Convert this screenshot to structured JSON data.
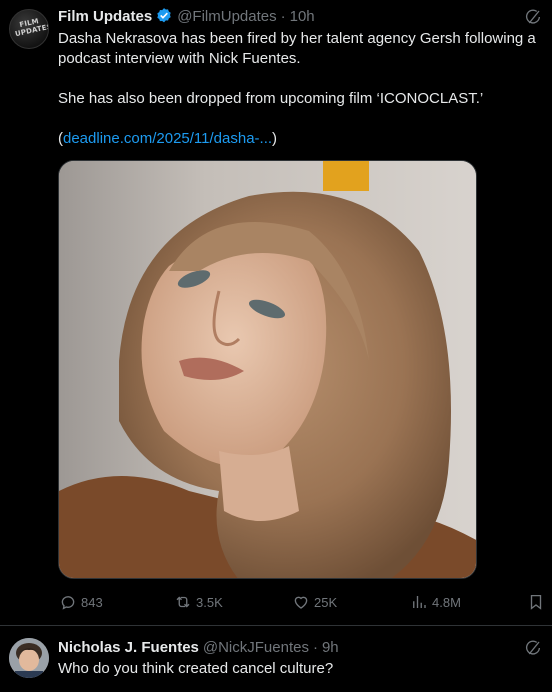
{
  "tweet": {
    "author_name": "Film Updates",
    "handle": "@FilmUpdates",
    "separator": "·",
    "time": "10h",
    "avatar_text_line1": "FILM",
    "avatar_text_line2": "UPDATES",
    "text_line1": "Dasha Nekrasova has been fired by her talent agency Gersh following a",
    "text_line2": "podcast interview with Nick Fuentes.",
    "text_line3": "She has also been dropped from upcoming film ‘ICONOCLAST.’",
    "link_open": "(",
    "link_text": "deadline.com/2025/11/dasha-...",
    "link_close": ")",
    "stats": {
      "replies": "843",
      "reposts": "3.5K",
      "likes": "25K",
      "views": "4.8M"
    }
  },
  "reply": {
    "author_name": "Nicholas J. Fuentes",
    "handle": "@NickJFuentes",
    "separator": "·",
    "time": "9h",
    "text": "Who do you think created cancel culture?"
  },
  "colors": {
    "background": "#000000",
    "text": "#e7e9ea",
    "muted": "#71767b",
    "link": "#1d9bf0",
    "verified": "#1d9bf0",
    "border": "#2f3336"
  }
}
